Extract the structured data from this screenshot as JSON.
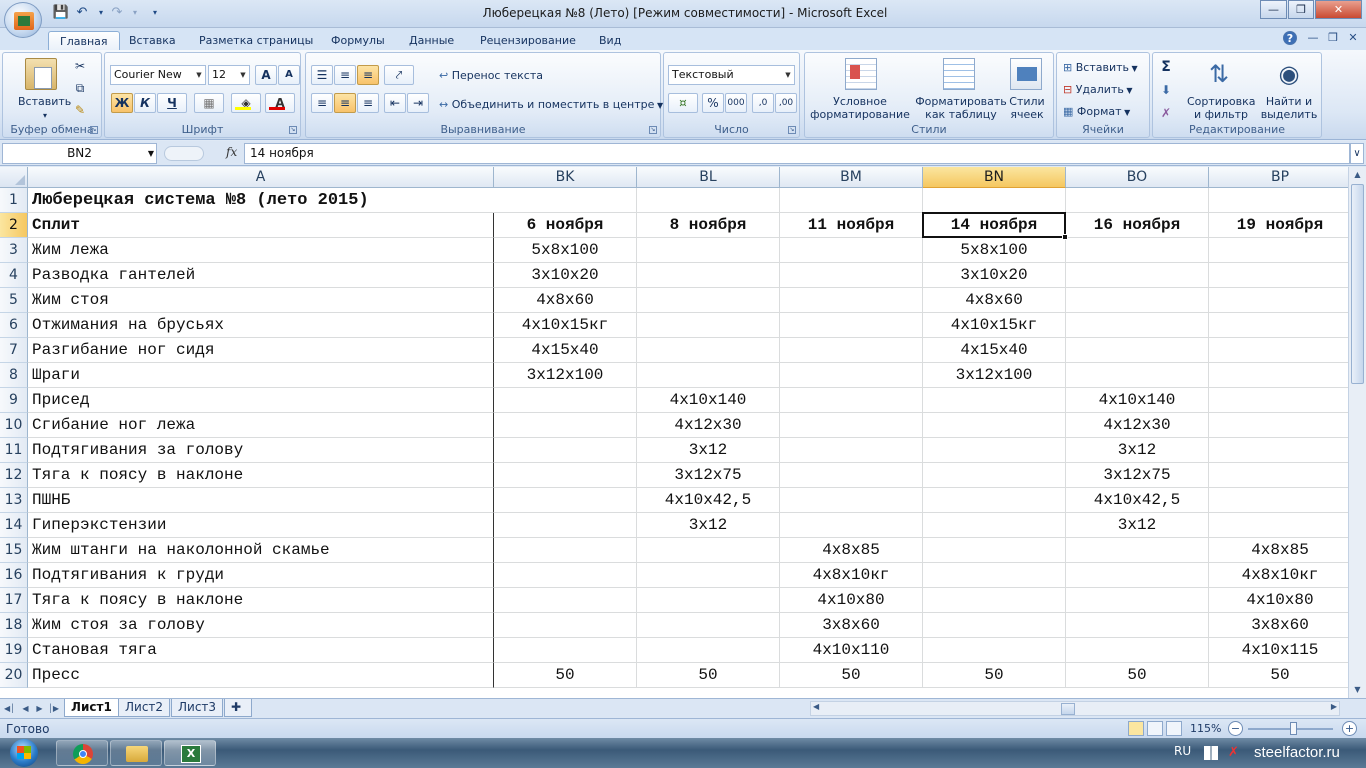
{
  "window": {
    "title": "Люберецкая №8 (Лето)  [Режим совместимости] - Microsoft Excel",
    "minimize": "—",
    "restore": "❒",
    "close": "✕"
  },
  "qat": {
    "save": "💾",
    "undo": "↶",
    "redo": "↷",
    "more": "▾"
  },
  "ribbon_tabs": [
    "Главная",
    "Вставка",
    "Разметка страницы",
    "Формулы",
    "Данные",
    "Рецензирование",
    "Вид"
  ],
  "ribbon": {
    "clipboard": {
      "label": "Буфер обмена",
      "paste": "Вставить"
    },
    "font": {
      "label": "Шрифт",
      "font_name": "Courier New",
      "font_size": "12",
      "bold": "Ж",
      "italic": "К",
      "underline": "Ч",
      "grow": "A",
      "shrink": "A",
      "fill_letter": "A"
    },
    "alignment": {
      "label": "Выравнивание",
      "wrap": "Перенос текста",
      "merge": "Объединить и поместить в центре"
    },
    "number": {
      "label": "Число",
      "format": "Текстовый",
      "percent": "%",
      "thousands": "000",
      "inc": ",0",
      "dec": ",00"
    },
    "styles": {
      "label": "Стили",
      "conditional": "Условное форматирование",
      "as_table": "Форматировать как таблицу",
      "cell_styles": "Стили ячеек"
    },
    "cells": {
      "label": "Ячейки",
      "insert": "Вставить",
      "delete": "Удалить",
      "format": "Формат"
    },
    "editing": {
      "label": "Редактирование",
      "sigma": "Σ",
      "sort": "Сортировка и фильтр",
      "find": "Найти и выделить"
    }
  },
  "formula_bar": {
    "name_box": "BN2",
    "fx": "fx",
    "value": "14 ноября"
  },
  "columns": [
    "A",
    "BK",
    "BL",
    "BM",
    "BN",
    "BO",
    "BP"
  ],
  "selected_column": "BN",
  "rows": [
    {
      "n": "1",
      "cells": [
        "Люберецкая система №8 (лето 2015)",
        "",
        "",
        "",
        "",
        "",
        ""
      ]
    },
    {
      "n": "2",
      "cells": [
        "Сплит",
        "6 ноября",
        "8 ноября",
        "11 ноября",
        "14 ноября",
        "16 ноября",
        "19 ноября"
      ]
    },
    {
      "n": "3",
      "cells": [
        "Жим лежа",
        "5х8х100",
        "",
        "",
        "5х8х100",
        "",
        ""
      ]
    },
    {
      "n": "4",
      "cells": [
        "Разводка гантелей",
        "3х10х20",
        "",
        "",
        "3х10х20",
        "",
        ""
      ]
    },
    {
      "n": "5",
      "cells": [
        "Жим стоя",
        "4х8х60",
        "",
        "",
        "4х8х60",
        "",
        ""
      ]
    },
    {
      "n": "6",
      "cells": [
        "Отжимания на брусьях",
        "4х10х15кг",
        "",
        "",
        "4х10х15кг",
        "",
        ""
      ]
    },
    {
      "n": "7",
      "cells": [
        "Разгибание ног сидя",
        "4х15х40",
        "",
        "",
        "4х15х40",
        "",
        ""
      ]
    },
    {
      "n": "8",
      "cells": [
        "Шраги",
        "3х12х100",
        "",
        "",
        "3х12х100",
        "",
        ""
      ]
    },
    {
      "n": "9",
      "cells": [
        "Присед",
        "",
        "4х10х140",
        "",
        "",
        "4х10х140",
        ""
      ]
    },
    {
      "n": "10",
      "cells": [
        "Сгибание ног лежа",
        "",
        "4х12х30",
        "",
        "",
        "4х12х30",
        ""
      ]
    },
    {
      "n": "11",
      "cells": [
        "Подтягивания за голову",
        "",
        "3х12",
        "",
        "",
        "3х12",
        ""
      ]
    },
    {
      "n": "12",
      "cells": [
        "Тяга к поясу в наклоне",
        "",
        "3х12х75",
        "",
        "",
        "3х12х75",
        ""
      ]
    },
    {
      "n": "13",
      "cells": [
        "ПШНБ",
        "",
        "4х10х42,5",
        "",
        "",
        "4х10х42,5",
        ""
      ]
    },
    {
      "n": "14",
      "cells": [
        "Гиперэкстензии",
        "",
        "3х12",
        "",
        "",
        "3х12",
        ""
      ]
    },
    {
      "n": "15",
      "cells": [
        "Жим штанги на наколонной скамье",
        "",
        "",
        "4х8х85",
        "",
        "",
        "4х8х85"
      ]
    },
    {
      "n": "16",
      "cells": [
        "Подтягивания к груди",
        "",
        "",
        "4х8х10кг",
        "",
        "",
        "4х8х10кг"
      ]
    },
    {
      "n": "17",
      "cells": [
        "Тяга к поясу в наклоне",
        "",
        "",
        "4х10х80",
        "",
        "",
        "4х10х80"
      ]
    },
    {
      "n": "18",
      "cells": [
        "Жим стоя за голову",
        "",
        "",
        "3х8х60",
        "",
        "",
        "3х8х60"
      ]
    },
    {
      "n": "19",
      "cells": [
        "Становая тяга",
        "",
        "",
        "4х10х110",
        "",
        "",
        "4х10х115"
      ]
    },
    {
      "n": "20",
      "cells": [
        "Пресс",
        "50",
        "50",
        "50",
        "50",
        "50",
        "50"
      ]
    }
  ],
  "sheet_tabs": [
    "Лист1",
    "Лист2",
    "Лист3"
  ],
  "status": {
    "ready": "Готово",
    "zoom": "115%",
    "zoom_minus": "−",
    "zoom_plus": "+"
  },
  "taskbar": {
    "lang": "RU",
    "watermark": "steelfactor.ru"
  },
  "colors": {
    "accent": "#f5c760",
    "ribbon": "#dce7f5",
    "grid": "#dadcdd"
  }
}
